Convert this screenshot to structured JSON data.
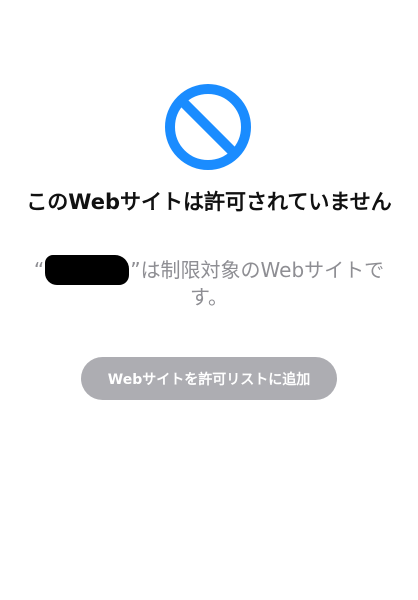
{
  "blocked_page": {
    "icon": "prohibited-icon",
    "accent_color": "#1a8cff",
    "title": "このWebサイトは許可されていません",
    "message": {
      "open_quote": "“",
      "close_quote": "”",
      "suffix": "は制限対象のWebサイトです。"
    },
    "add_button_label": "Webサイトを許可リストに追加"
  }
}
